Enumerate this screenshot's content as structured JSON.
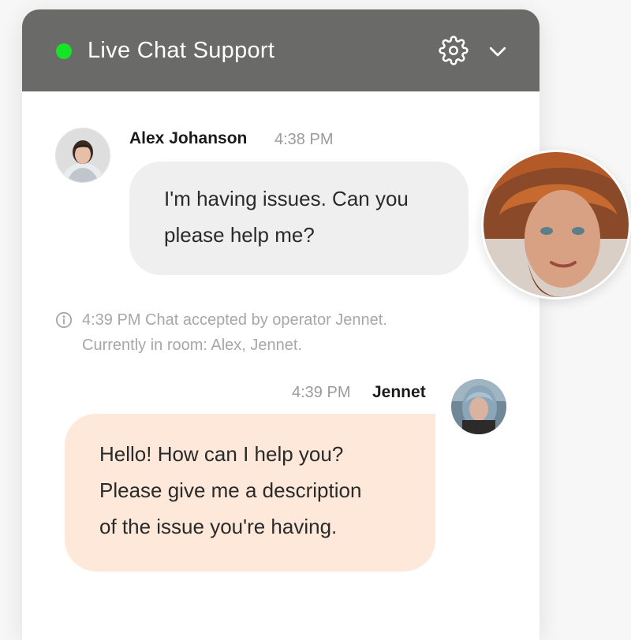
{
  "header": {
    "title": "Live Chat Support",
    "status_color": "#14e327",
    "settings_icon": "gear-icon",
    "collapse_icon": "chevron-down-icon"
  },
  "messages": [
    {
      "sender": "Alex Johanson",
      "time": "4:38 PM",
      "text": "I'm having issues. Can you\nplease help me?",
      "direction": "incoming"
    },
    {
      "sender": "Jennet",
      "time": "4:39 PM",
      "text": "Hello! How can I help you?\nPlease give me a description\nof the issue you're having.",
      "direction": "outgoing"
    }
  ],
  "system_message": {
    "icon": "info-icon",
    "text": "4:39 PM Chat accepted by operator Jennet.\nCurrently in room: Alex, Jennet."
  },
  "colors": {
    "header_bg": "#6a6a69",
    "incoming_bubble": "#efefef",
    "outgoing_bubble": "#fde8da"
  }
}
